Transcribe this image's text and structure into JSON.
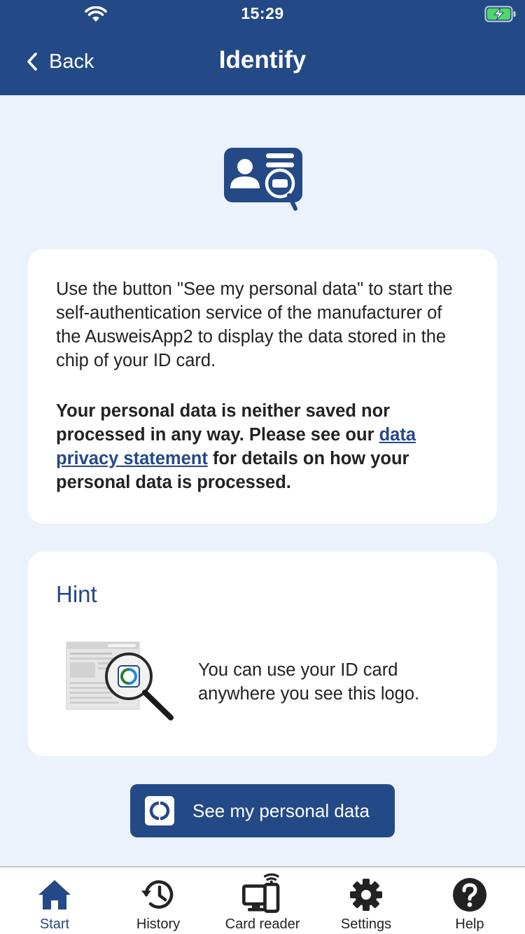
{
  "status_bar": {
    "time": "15:29"
  },
  "header": {
    "back_label": "Back",
    "title": "Identify"
  },
  "info_card": {
    "paragraph": "Use the button \"See my personal data\" to start the self-authentication service of the manufacturer of the AusweisApp2 to display the data stored in the chip of your ID card.",
    "bold_before_link": "Your personal data is neither saved nor processed in any way. Please see our ",
    "link_text": "data privacy statement",
    "bold_after_link": " for details on how your personal data is processed."
  },
  "hint_card": {
    "title": "Hint",
    "text": "You can use your ID card anywhere you see this logo."
  },
  "primary_button": {
    "label": "See my personal data"
  },
  "tabs": [
    {
      "label": "Start",
      "icon": "home-icon",
      "active": true
    },
    {
      "label": "History",
      "icon": "history-icon",
      "active": false
    },
    {
      "label": "Card reader",
      "icon": "card-reader-icon",
      "active": false
    },
    {
      "label": "Settings",
      "icon": "gear-icon",
      "active": false
    },
    {
      "label": "Help",
      "icon": "help-icon",
      "active": false
    }
  ],
  "colors": {
    "brand": "#244987",
    "background": "#ebf2fc",
    "card": "#ffffff",
    "battery": "#4cd964"
  }
}
